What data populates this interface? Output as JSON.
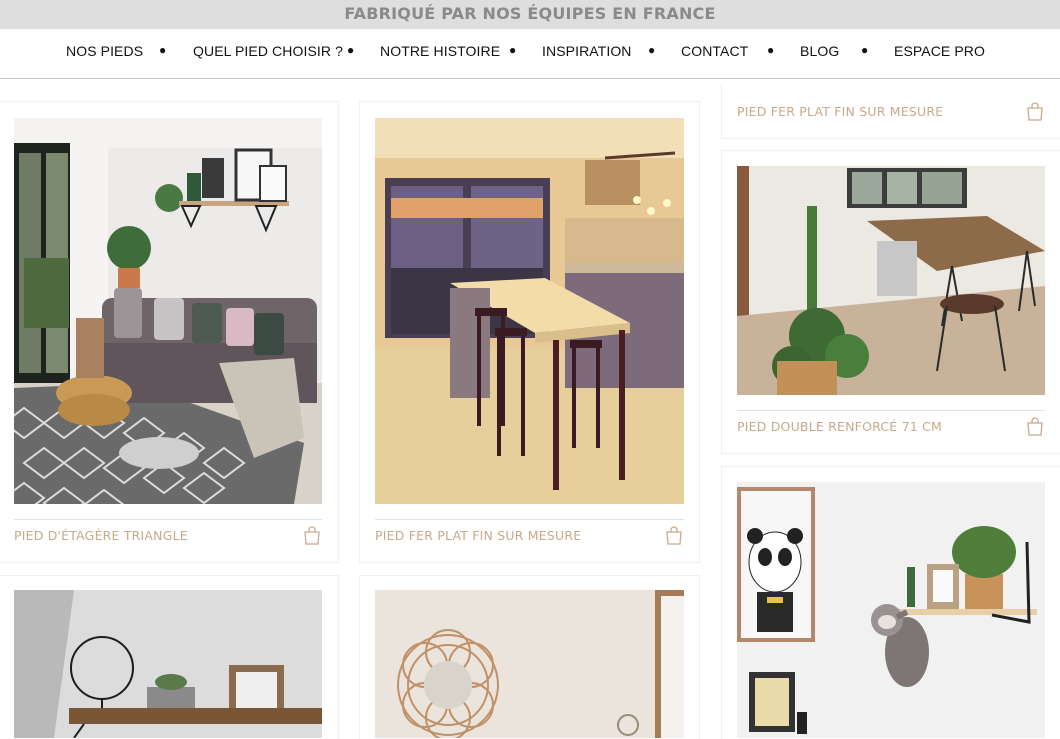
{
  "banner": {
    "text": "FABRIQUÉ PAR NOS ÉQUIPES EN FRANCE"
  },
  "nav": {
    "items": [
      "NOS PIEDS",
      "QUEL PIED CHOISIR ?",
      "NOTRE HISTOIRE",
      "INSPIRATION",
      "CONTACT",
      "BLOG",
      "ESPACE PRO"
    ],
    "separator": "●"
  },
  "products": {
    "col1_card1": {
      "title": "PIED D'ÉTAGÈRE TRIANGLE",
      "image": "living-room-sofa-triangle-shelf"
    },
    "col2_card1": {
      "title": "PIED FER PLAT FIN SUR MESURE",
      "image": "kitchen-bar-table-stools"
    },
    "col3_card0": {
      "title": "PIED FER PLAT FIN SUR MESURE"
    },
    "col3_card1": {
      "title": "PIED DOUBLE RENFORCÉ 71 CM",
      "image": "dining-table-hairpin-legs"
    },
    "col3_card2": {
      "image": "wall-shelf-panda-sloth"
    },
    "col1_card2": {
      "image": "console-ring-frame"
    },
    "col2_card2": {
      "image": "rattan-mirror-console"
    }
  },
  "colors": {
    "caption": "#c8a98c",
    "banner_bg": "#dededf",
    "banner_text": "#8a8a8a"
  },
  "icons": {
    "cart": "shopping-bag-icon"
  }
}
